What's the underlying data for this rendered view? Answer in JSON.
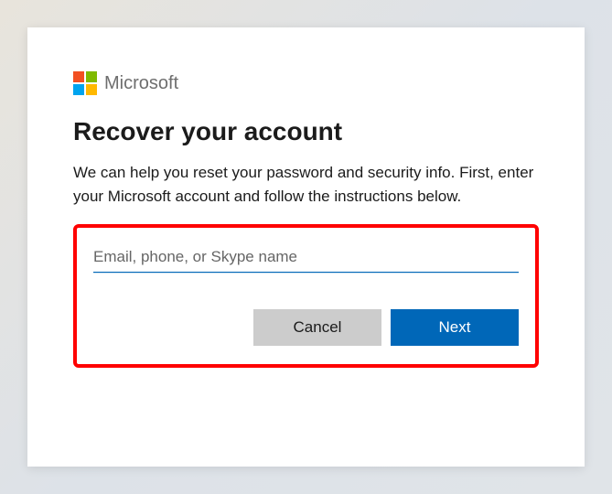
{
  "brand": {
    "name": "Microsoft"
  },
  "page": {
    "title": "Recover your account",
    "description": "We can help you reset your password and security info. First, enter your Microsoft account and follow the instructions below."
  },
  "form": {
    "account_placeholder": "Email, phone, or Skype name",
    "account_value": ""
  },
  "buttons": {
    "cancel": "Cancel",
    "next": "Next"
  }
}
